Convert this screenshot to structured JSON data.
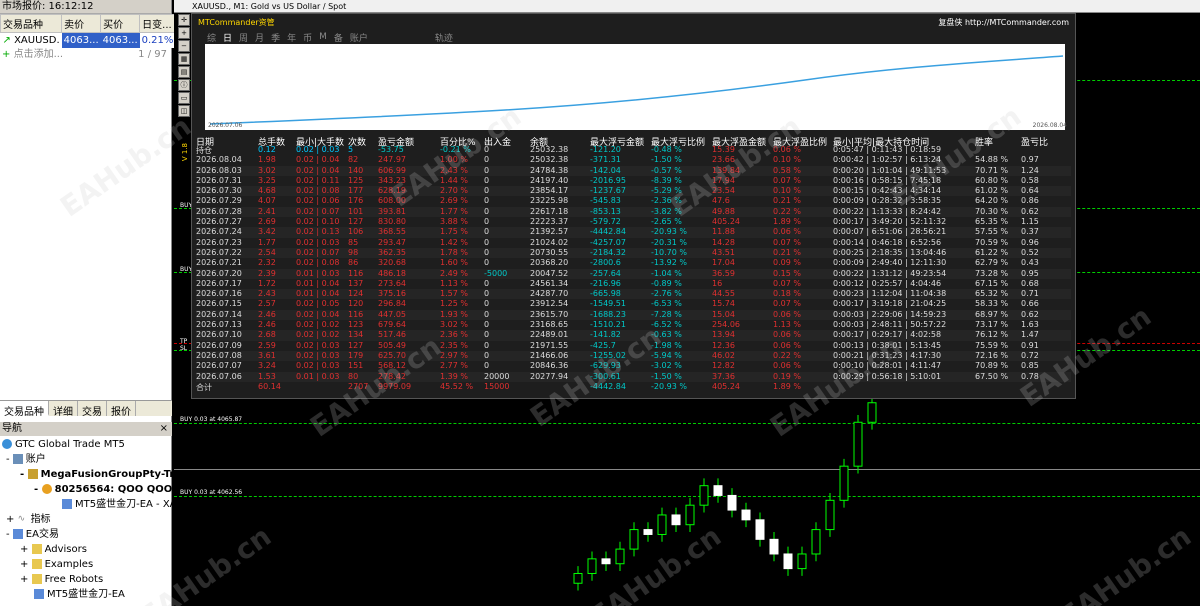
{
  "market_watch": {
    "title": "市场报价: 16:12:12",
    "columns": [
      "交易品种",
      "卖价",
      "买价",
      "日变..."
    ],
    "rows": [
      {
        "symbol": "XAUUSD.",
        "bid": "4063...",
        "ask": "4063...",
        "change": "0.21%"
      }
    ],
    "add_label": "点击添加...",
    "count": "1 / 97",
    "tabs": [
      "交易品种",
      "详细",
      "交易",
      "报价"
    ]
  },
  "navigator": {
    "title": "导航",
    "items": [
      {
        "label": "GTC Global Trade MT5"
      },
      {
        "label": "账户"
      },
      {
        "label": "MegaFusionGroupPty-Trad"
      },
      {
        "label": "80256564: QOO QOO"
      },
      {
        "label": "MT5盛世金刀-EA - XA"
      },
      {
        "label": "指标"
      },
      {
        "label": "EA交易"
      },
      {
        "label": "Advisors"
      },
      {
        "label": "Examples"
      },
      {
        "label": "Free Robots"
      },
      {
        "label": "MT5盛世金刀-EA"
      }
    ]
  },
  "chart": {
    "title": "XAUUSD., M1: Gold vs US Dollar / Spot",
    "panel_brand": "MTCommander资管",
    "panel_right": "复盘侠 http://MTCommander.com",
    "tabs": [
      "综",
      "日",
      "周",
      "月",
      "季",
      "年",
      "币",
      "M",
      "备",
      "账户",
      "轨迹"
    ],
    "equity_start_date": "2026.07.06",
    "equity_end_date": "2026.08.04",
    "side_text": "V 1.8",
    "buy_labels": [
      "BUY",
      "BUY",
      "BUY 0.03 at 4065.87",
      "BUY 0.03 at 4062.56",
      "TP",
      "SL"
    ],
    "watermark": "EAHub.cn"
  },
  "stats": {
    "headers": [
      "日期",
      "总手数",
      "最小|大手数",
      "次数",
      "盈亏金额",
      "百分比%",
      "出入金",
      "余额",
      "最大浮亏金额",
      "最大浮亏比例",
      "最大浮盈金额",
      "最大浮盈比例",
      "最小|平均|最大持仓时间",
      "胜率",
      "盈亏比"
    ],
    "hold": {
      "date": "持仓",
      "lots": "0.12",
      "minmax": "0.02 | 0.03",
      "count": "5",
      "pnl": "-53.75",
      "pct": "-0.21 %",
      "io": "0",
      "bal": "25032.38",
      "fl": "-121.20",
      "flp": "-0.48 %",
      "fp": "15.39",
      "fpp": "0.06 %",
      "time": "0:05:47 | 0:11:43 | 0:18:59",
      "win": "",
      "rr": ""
    },
    "rows": [
      {
        "date": "2026.08.04",
        "lots": "1.98",
        "minmax": "0.02 | 0.04",
        "count": "82",
        "pnl": "247.97",
        "pct": "1.00 %",
        "io": "0",
        "bal": "25032.38",
        "fl": "-371.31",
        "flp": "-1.50 %",
        "fp": "23.66",
        "fpp": "0.10 %",
        "time": "0:00:42 | 1:02:57 | 6:13:24",
        "win": "54.88 %",
        "rr": "0.97"
      },
      {
        "date": "2026.08.03",
        "lots": "3.02",
        "minmax": "0.02 | 0.04",
        "count": "140",
        "pnl": "606.99",
        "pct": "2.43 %",
        "io": "0",
        "bal": "24784.38",
        "fl": "-142.04",
        "flp": "-0.57 %",
        "fp": "139.84",
        "fpp": "0.58 %",
        "time": "0:00:20 | 1:01:04 | 49:11:53",
        "win": "70.71 %",
        "rr": "1.24"
      },
      {
        "date": "2026.07.31",
        "lots": "3.25",
        "minmax": "0.02 | 0.11",
        "count": "125",
        "pnl": "343.23",
        "pct": "1.44 %",
        "io": "0",
        "bal": "24197.40",
        "fl": "-2016.95",
        "flp": "-8.39 %",
        "fp": "17.94",
        "fpp": "0.07 %",
        "time": "0:00:16 | 0:58:15 | 7:45:18",
        "win": "60.80 %",
        "rr": "0.58"
      },
      {
        "date": "2026.07.30",
        "lots": "4.68",
        "minmax": "0.02 | 0.08",
        "count": "177",
        "pnl": "628.19",
        "pct": "2.70 %",
        "io": "0",
        "bal": "23854.17",
        "fl": "-1237.67",
        "flp": "-5.29 %",
        "fp": "23.54",
        "fpp": "0.10 %",
        "time": "0:00:15 | 0:42:43 | 4:34:14",
        "win": "61.02 %",
        "rr": "0.64"
      },
      {
        "date": "2026.07.29",
        "lots": "4.07",
        "minmax": "0.02 | 0.06",
        "count": "176",
        "pnl": "608.00",
        "pct": "2.69 %",
        "io": "0",
        "bal": "23225.98",
        "fl": "-545.83",
        "flp": "-2.36 %",
        "fp": "47.6",
        "fpp": "0.21 %",
        "time": "0:00:09 | 0:28:32 | 3:58:35",
        "win": "64.20 %",
        "rr": "0.86"
      },
      {
        "date": "2026.07.28",
        "lots": "2.41",
        "minmax": "0.02 | 0.07",
        "count": "101",
        "pnl": "393.81",
        "pct": "1.77 %",
        "io": "0",
        "bal": "22617.18",
        "fl": "-853.13",
        "flp": "-3.82 %",
        "fp": "49.88",
        "fpp": "0.22 %",
        "time": "0:00:22 | 1:13:33 | 8:24:42",
        "win": "70.30 %",
        "rr": "0.62"
      },
      {
        "date": "2026.07.27",
        "lots": "2.69",
        "minmax": "0.02 | 0.10",
        "count": "127",
        "pnl": "830.80",
        "pct": "3.88 %",
        "io": "0",
        "bal": "22223.37",
        "fl": "-579.72",
        "flp": "-2.65 %",
        "fp": "405.24",
        "fpp": "1.89 %",
        "time": "0:00:17 | 3:49:20 | 52:11:32",
        "win": "65.35 %",
        "rr": "1.15"
      },
      {
        "date": "2026.07.24",
        "lots": "3.42",
        "minmax": "0.02 | 0.13",
        "count": "106",
        "pnl": "368.55",
        "pct": "1.75 %",
        "io": "0",
        "bal": "21392.57",
        "fl": "-4442.84",
        "flp": "-20.93 %",
        "fp": "11.88",
        "fpp": "0.06 %",
        "time": "0:00:07 | 6:51:06 | 28:56:21",
        "win": "57.55 %",
        "rr": "0.37"
      },
      {
        "date": "2026.07.23",
        "lots": "1.77",
        "minmax": "0.02 | 0.03",
        "count": "85",
        "pnl": "293.47",
        "pct": "1.42 %",
        "io": "0",
        "bal": "21024.02",
        "fl": "-4257.07",
        "flp": "-20.31 %",
        "fp": "14.28",
        "fpp": "0.07 %",
        "time": "0:00:14 | 0:46:18 | 6:52:56",
        "win": "70.59 %",
        "rr": "0.96"
      },
      {
        "date": "2026.07.22",
        "lots": "2.54",
        "minmax": "0.02 | 0.07",
        "count": "98",
        "pnl": "362.35",
        "pct": "1.78 %",
        "io": "0",
        "bal": "20730.55",
        "fl": "-2184.32",
        "flp": "-10.70 %",
        "fp": "43.51",
        "fpp": "0.21 %",
        "time": "0:00:25 | 2:18:35 | 13:04:46",
        "win": "61.22 %",
        "rr": "0.52"
      },
      {
        "date": "2026.07.21",
        "lots": "2.32",
        "minmax": "0.02 | 0.08",
        "count": "86",
        "pnl": "320.68",
        "pct": "1.60 %",
        "io": "0",
        "bal": "20368.20",
        "fl": "-2800.6",
        "flp": "-13.92 %",
        "fp": "17.04",
        "fpp": "0.09 %",
        "time": "0:00:09 | 2:49:40 | 12:11:30",
        "win": "62.79 %",
        "rr": "0.43"
      },
      {
        "date": "2026.07.20",
        "lots": "2.39",
        "minmax": "0.01 | 0.03",
        "count": "116",
        "pnl": "486.18",
        "pct": "2.49 %",
        "io": "-5000",
        "bal": "20047.52",
        "fl": "-257.64",
        "flp": "-1.04 %",
        "fp": "36.59",
        "fpp": "0.15 %",
        "time": "0:00:22 | 1:31:12 | 49:23:54",
        "win": "73.28 %",
        "rr": "0.95"
      },
      {
        "date": "2026.07.17",
        "lots": "1.72",
        "minmax": "0.01 | 0.04",
        "count": "137",
        "pnl": "273.64",
        "pct": "1.13 %",
        "io": "0",
        "bal": "24561.34",
        "fl": "-216.96",
        "flp": "-0.89 %",
        "fp": "16",
        "fpp": "0.07 %",
        "time": "0:00:12 | 0:25:57 | 4:04:46",
        "win": "67.15 %",
        "rr": "0.68"
      },
      {
        "date": "2026.07.16",
        "lots": "2.43",
        "minmax": "0.01 | 0.04",
        "count": "124",
        "pnl": "375.16",
        "pct": "1.57 %",
        "io": "0",
        "bal": "24287.70",
        "fl": "-665.98",
        "flp": "-2.76 %",
        "fp": "44.55",
        "fpp": "0.18 %",
        "time": "0:00:23 | 1:12:04 | 11:04:38",
        "win": "65.32 %",
        "rr": "0.71"
      },
      {
        "date": "2026.07.15",
        "lots": "2.57",
        "minmax": "0.02 | 0.05",
        "count": "120",
        "pnl": "296.84",
        "pct": "1.25 %",
        "io": "0",
        "bal": "23912.54",
        "fl": "-1549.51",
        "flp": "-6.53 %",
        "fp": "15.74",
        "fpp": "0.07 %",
        "time": "0:00:17 | 3:19:18 | 21:04:25",
        "win": "58.33 %",
        "rr": "0.66"
      },
      {
        "date": "2026.07.14",
        "lots": "2.46",
        "minmax": "0.02 | 0.04",
        "count": "116",
        "pnl": "447.05",
        "pct": "1.93 %",
        "io": "0",
        "bal": "23615.70",
        "fl": "-1688.23",
        "flp": "-7.28 %",
        "fp": "15.04",
        "fpp": "0.06 %",
        "time": "0:00:03 | 2:29:06 | 14:59:23",
        "win": "68.97 %",
        "rr": "0.62"
      },
      {
        "date": "2026.07.13",
        "lots": "2.46",
        "minmax": "0.02 | 0.02",
        "count": "123",
        "pnl": "679.64",
        "pct": "3.02 %",
        "io": "0",
        "bal": "23168.65",
        "fl": "-1510.21",
        "flp": "-6.52 %",
        "fp": "254.06",
        "fpp": "1.13 %",
        "time": "0:00:03 | 2:48:11 | 50:57:22",
        "win": "73.17 %",
        "rr": "1.63"
      },
      {
        "date": "2026.07.10",
        "lots": "2.68",
        "minmax": "0.02 | 0.02",
        "count": "134",
        "pnl": "517.46",
        "pct": "2.36 %",
        "io": "0",
        "bal": "22489.01",
        "fl": "-141.82",
        "flp": "-0.63 %",
        "fp": "13.94",
        "fpp": "0.06 %",
        "time": "0:00:17 | 0:29:17 | 4:02:58",
        "win": "76.12 %",
        "rr": "1.47"
      },
      {
        "date": "2026.07.09",
        "lots": "2.59",
        "minmax": "0.02 | 0.03",
        "count": "127",
        "pnl": "505.49",
        "pct": "2.35 %",
        "io": "0",
        "bal": "21971.55",
        "fl": "-425.7",
        "flp": "-1.98 %",
        "fp": "12.36",
        "fpp": "0.06 %",
        "time": "0:00:13 | 0:38:01 | 5:13:45",
        "win": "75.59 %",
        "rr": "0.91"
      },
      {
        "date": "2026.07.08",
        "lots": "3.61",
        "minmax": "0.02 | 0.03",
        "count": "179",
        "pnl": "625.70",
        "pct": "2.97 %",
        "io": "0",
        "bal": "21466.06",
        "fl": "-1255.02",
        "flp": "-5.94 %",
        "fp": "46.02",
        "fpp": "0.22 %",
        "time": "0:00:21 | 0:31:23 | 4:17:30",
        "win": "72.16 %",
        "rr": "0.72"
      },
      {
        "date": "2026.07.07",
        "lots": "3.24",
        "minmax": "0.02 | 0.03",
        "count": "151",
        "pnl": "568.12",
        "pct": "2.77 %",
        "io": "0",
        "bal": "20846.36",
        "fl": "-629.93",
        "flp": "-3.02 %",
        "fp": "12.82",
        "fpp": "0.06 %",
        "time": "0:00:10 | 0:28:01 | 4:11:47",
        "win": "70.89 %",
        "rr": "0.85"
      },
      {
        "date": "2026.07.06",
        "lots": "1.53",
        "minmax": "0.01 | 0.03",
        "count": "80",
        "pnl": "278.42",
        "pct": "1.39 %",
        "io": "20000",
        "bal": "20277.94",
        "fl": "-300.61",
        "flp": "-1.50 %",
        "fp": "37.36",
        "fpp": "0.19 %",
        "time": "0:00:29 | 0:56:18 | 5:10:01",
        "win": "67.50 %",
        "rr": "0.78"
      }
    ],
    "total": {
      "date": "合计",
      "lots": "60.14",
      "minmax": "",
      "count": "2707",
      "pnl": "9979.09",
      "pct": "45.52 %",
      "io": "15000",
      "bal": "",
      "fl": "-4442.84",
      "flp": "-20.93 %",
      "fp": "405.24",
      "fpp": "1.89 %",
      "time": "",
      "win": "",
      "rr": ""
    }
  },
  "candles": [
    {
      "o": 4057,
      "c": 4059
    },
    {
      "o": 4059,
      "c": 4062
    },
    {
      "o": 4062,
      "c": 4061
    },
    {
      "o": 4061,
      "c": 4064
    },
    {
      "o": 4064,
      "c": 4068
    },
    {
      "o": 4068,
      "c": 4067
    },
    {
      "o": 4067,
      "c": 4071
    },
    {
      "o": 4071,
      "c": 4069
    },
    {
      "o": 4069,
      "c": 4073
    },
    {
      "o": 4073,
      "c": 4077
    },
    {
      "o": 4077,
      "c": 4075
    },
    {
      "o": 4075,
      "c": 4072
    },
    {
      "o": 4072,
      "c": 4070
    },
    {
      "o": 4070,
      "c": 4066
    },
    {
      "o": 4066,
      "c": 4063
    },
    {
      "o": 4063,
      "c": 4060
    },
    {
      "o": 4060,
      "c": 4063
    },
    {
      "o": 4063,
      "c": 4068
    },
    {
      "o": 4068,
      "c": 4074
    },
    {
      "o": 4074,
      "c": 4081
    },
    {
      "o": 4081,
      "c": 4090
    },
    {
      "o": 4090,
      "c": 4094
    }
  ]
}
